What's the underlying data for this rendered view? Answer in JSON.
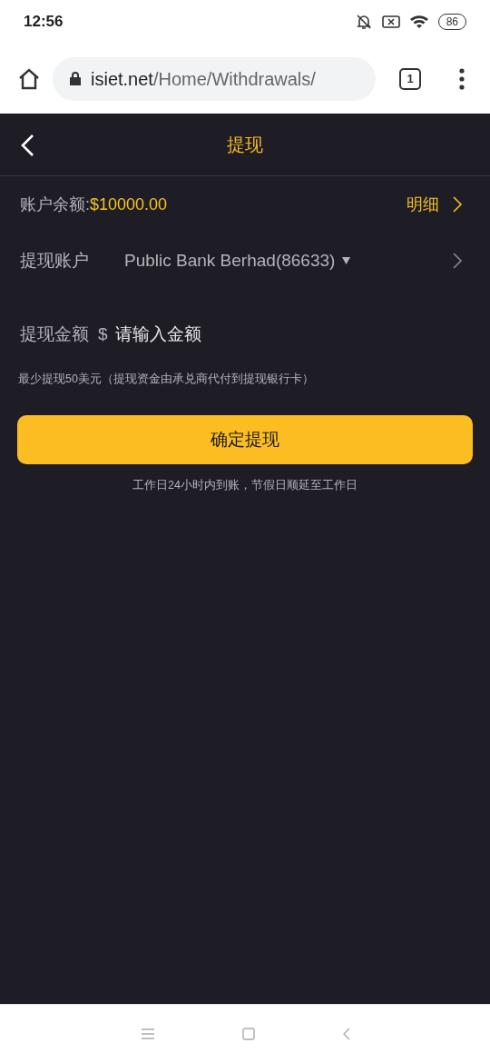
{
  "status_bar": {
    "time": "12:56",
    "battery": "86"
  },
  "browser": {
    "host": "isiet.net",
    "path": "/Home/Withdrawals/",
    "tab_count": "1"
  },
  "header": {
    "title": "提现"
  },
  "balance": {
    "label": "账户余额:",
    "value": "$10000.00",
    "link": "明细"
  },
  "account": {
    "label": "提现账户",
    "value": "Public Bank Berhad(86633)"
  },
  "amount": {
    "label": "提现金额",
    "currency": "$",
    "placeholder": "请输入金额"
  },
  "note": "最少提现50美元（提现资金由承兑商代付到提现银行卡）",
  "submit": "确定提现",
  "footnote": "工作日24小时内到账，节假日顺延至工作日"
}
